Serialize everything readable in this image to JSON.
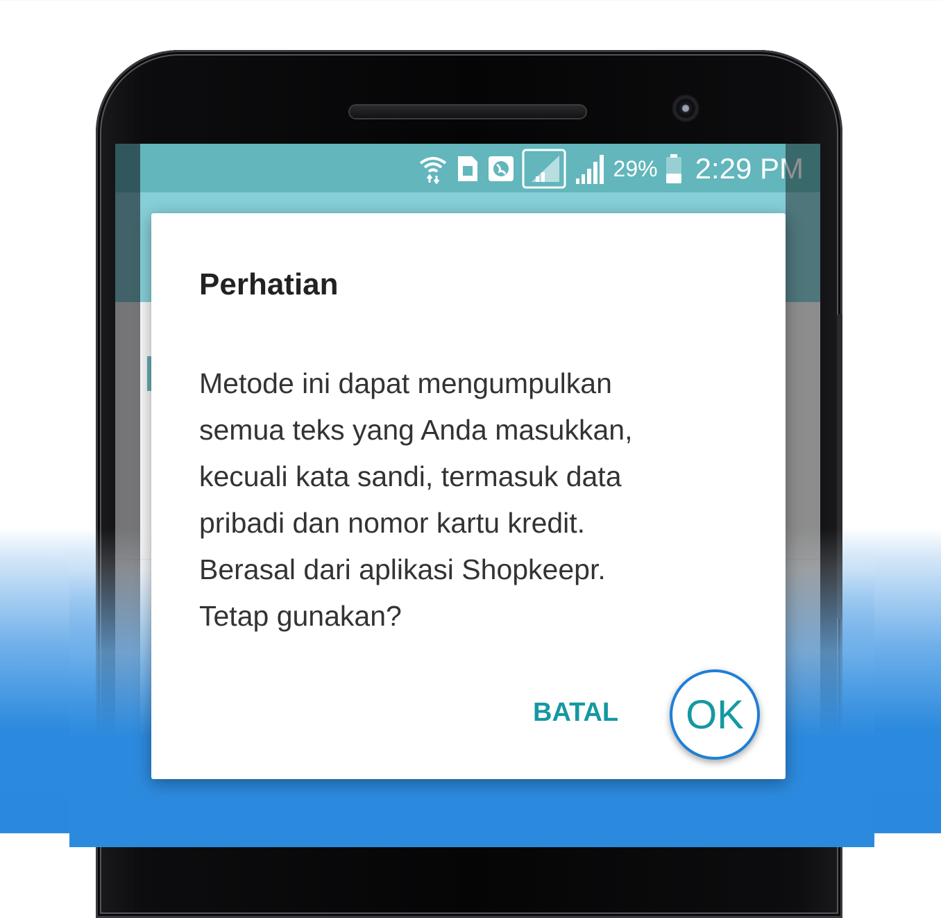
{
  "status_bar": {
    "battery_percent": "29%",
    "time": "2:29 PM",
    "icons": [
      "wifi-icon",
      "sim-card-icon",
      "globe-icon",
      "signal-box-icon",
      "signal-icon",
      "battery-icon"
    ]
  },
  "dialog": {
    "title": "Perhatian",
    "message_lines": [
      "Metode ini dapat mengumpulkan",
      "semua teks yang Anda masukkan,",
      "kecuali kata sandi, termasuk data",
      "pribadi dan nomor kartu kredit.",
      "Berasal dari aplikasi Shopkeepr.",
      "Tetap gunakan?"
    ],
    "cancel_label": "BATAL",
    "ok_label": "OK"
  },
  "colors": {
    "status_bar": "#0f8f99",
    "app_bar": "#46b4c4",
    "accent": "#1598a2",
    "highlight_ring": "#1e7fd6",
    "background_bottom": "#2a88dd"
  }
}
